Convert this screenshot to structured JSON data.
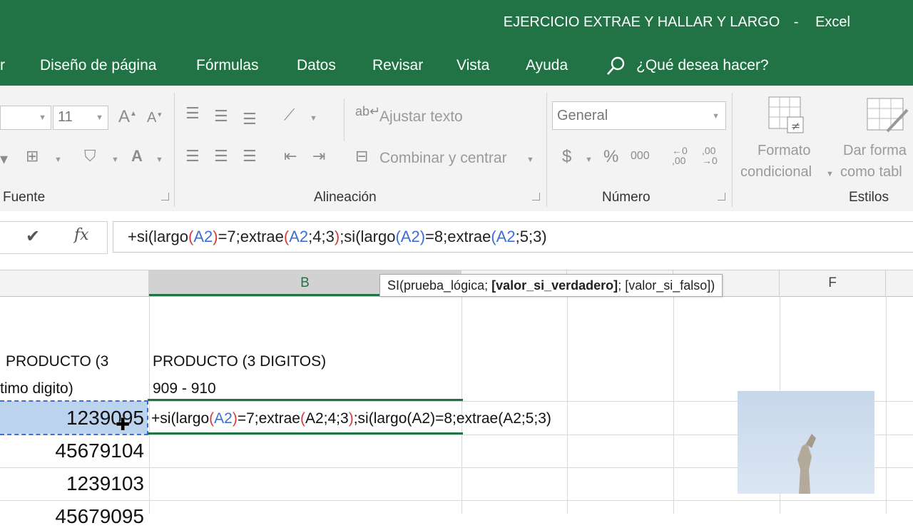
{
  "window": {
    "title": "EJERCICIO EXTRAE Y HALLAR Y LARGO",
    "separator": "-",
    "app": "Excel"
  },
  "menu": {
    "items": [
      "r",
      "Diseño de página",
      "Fórmulas",
      "Datos",
      "Revisar",
      "Vista",
      "Ayuda"
    ],
    "search_placeholder": "¿Qué desea hacer?"
  },
  "ribbon": {
    "font": {
      "label": "Fuente",
      "size": "11"
    },
    "alignment": {
      "label": "Alineación",
      "wrap_text": "Ajustar texto",
      "merge_center": "Combinar y centrar"
    },
    "number": {
      "label": "Número",
      "format": "General",
      "percent": "%",
      "thousands": "000",
      "currency": "$"
    },
    "styles": {
      "label": "Estilos",
      "conditional_line1": "Formato",
      "conditional_line2": "condicional",
      "table_line1": "Dar forma",
      "table_line2": "como tabl"
    }
  },
  "formula_bar": {
    "enter_symbol": "✔",
    "fx": "fx",
    "formula_parts": [
      {
        "t": "+si(largo",
        "c": "plain"
      },
      {
        "t": "(",
        "c": "paren"
      },
      {
        "t": "A2",
        "c": "ref"
      },
      {
        "t": ")",
        "c": "paren"
      },
      {
        "t": "=7;extrae",
        "c": "plain"
      },
      {
        "t": "(",
        "c": "paren"
      },
      {
        "t": "A2",
        "c": "ref"
      },
      {
        "t": ";4;3",
        "c": "plain"
      },
      {
        "t": ")",
        "c": "paren"
      },
      {
        "t": ";si(largo",
        "c": "plain"
      },
      {
        "t": "(",
        "c": "ref"
      },
      {
        "t": "A2",
        "c": "ref"
      },
      {
        "t": ")",
        "c": "ref"
      },
      {
        "t": "=8;extrae",
        "c": "plain"
      },
      {
        "t": "(",
        "c": "ref"
      },
      {
        "t": "A2",
        "c": "ref"
      },
      {
        "t": ";5;3)",
        "c": "plain"
      }
    ]
  },
  "tooltip": {
    "prefix": "SI(prueba_lógica; ",
    "bold": "[valor_si_verdadero]",
    "suffix": "; [valor_si_falso])"
  },
  "sheet": {
    "columns": [
      "B",
      "F"
    ],
    "headerA_line1": "PRODUCTO (3",
    "headerA_line2": "timo digito)",
    "headerB_line1": "PRODUCTO (3 DIGITOS)",
    "headerB_line2": "909 - 910",
    "values": [
      "1239095",
      "45679104",
      "1239103",
      "45679095"
    ],
    "editing_prefix": "+si",
    "editing_parts": [
      {
        "t": "(largo",
        "c": "plain"
      },
      {
        "t": "(",
        "c": "paren"
      },
      {
        "t": "A2",
        "c": "ref"
      },
      {
        "t": ")",
        "c": "paren"
      },
      {
        "t": "=7;extrae",
        "c": "plain"
      },
      {
        "t": "(",
        "c": "paren"
      },
      {
        "t": "A2;4;3",
        "c": "plain"
      },
      {
        "t": ")",
        "c": "paren"
      },
      {
        "t": ";si(largo(A2)=8;extrae(A2;5;3)",
        "c": "plain"
      }
    ]
  },
  "colors": {
    "excel_green": "#217346",
    "ref_blue": "#3b6fd6",
    "paren_red": "#d83b3b",
    "selection": "#bcd3ee"
  }
}
